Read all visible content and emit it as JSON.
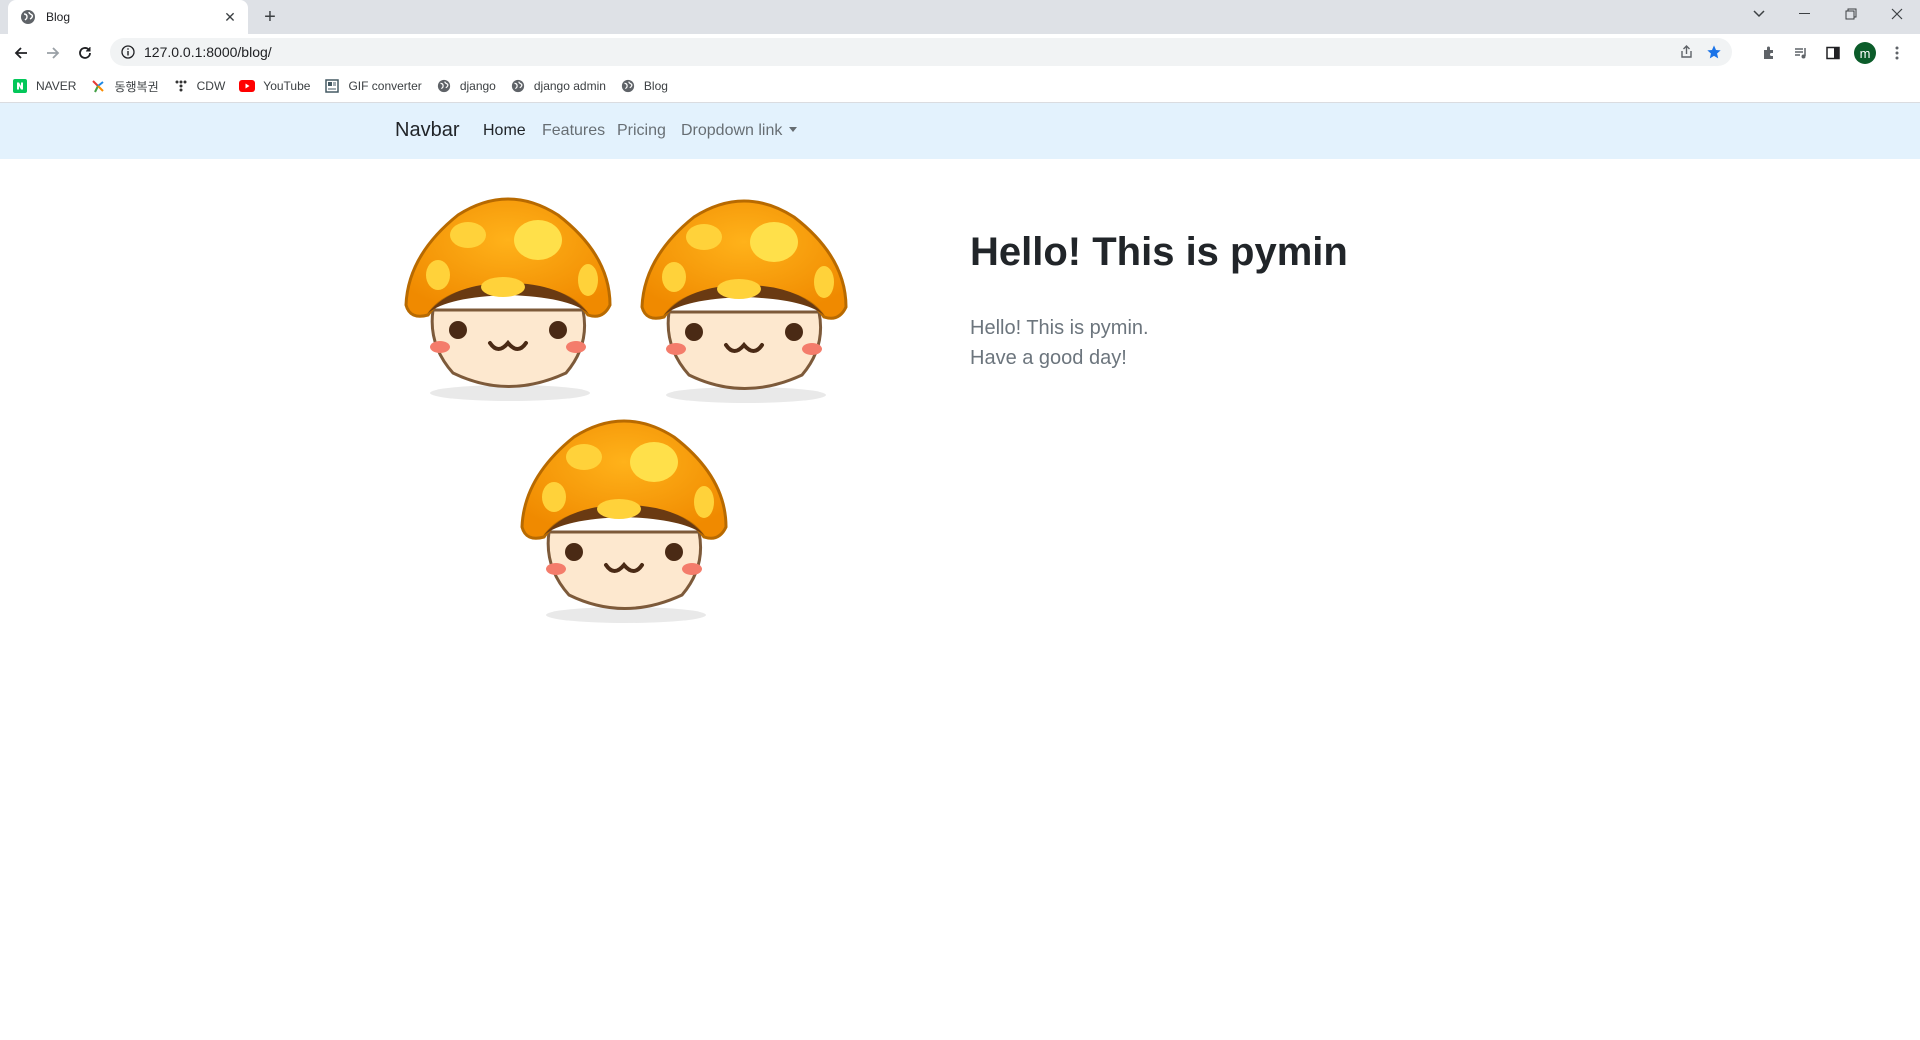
{
  "browser": {
    "tab_title": "Blog",
    "url": "127.0.0.1:8000/blog/",
    "profile_initial": "m",
    "bookmarks": [
      {
        "label": "NAVER",
        "icon": "naver-icon"
      },
      {
        "label": "동행복권",
        "icon": "lottery-icon"
      },
      {
        "label": "CDW",
        "icon": "cdw-icon"
      },
      {
        "label": "YouTube",
        "icon": "youtube-icon"
      },
      {
        "label": "GIF converter",
        "icon": "gif-icon"
      },
      {
        "label": "django",
        "icon": "globe-icon"
      },
      {
        "label": "django admin",
        "icon": "globe-icon"
      },
      {
        "label": "Blog",
        "icon": "globe-icon"
      }
    ],
    "colors": {
      "bookmark_star": "#1a73e8",
      "tab_strip": "#dee1e6"
    }
  },
  "navbar": {
    "brand": "Navbar",
    "links": [
      "Home",
      "Features",
      "Pricing",
      "Dropdown link"
    ],
    "active": "Home",
    "background": "#e3f2fd"
  },
  "main": {
    "heading": "Hello! This is pymin",
    "lines": [
      "Hello! This is pymin.",
      "Have a good day!"
    ]
  }
}
